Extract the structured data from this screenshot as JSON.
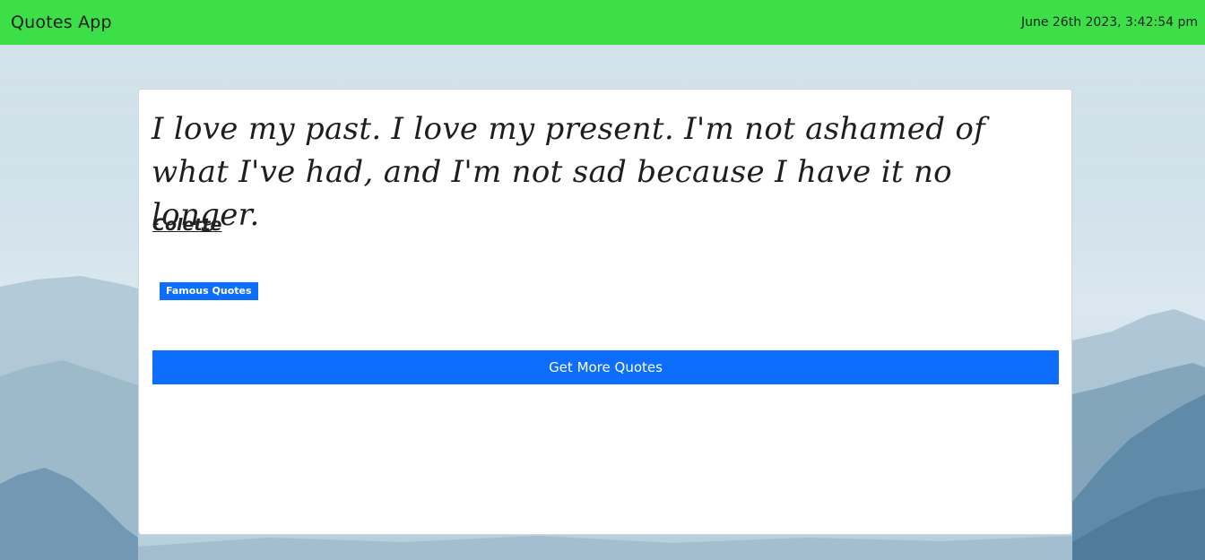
{
  "navbar": {
    "brand": "Quotes App",
    "datetime": "June 26th 2023, 3:42:54 pm",
    "background_color": "#3ddf48"
  },
  "quote": {
    "text": "I love my past. I love my present. I'm not ashamed of what I've had, and I'm not sad because I have it no longer.",
    "author": "Colette",
    "tags": [
      "Famous Quotes"
    ]
  },
  "actions": {
    "more_label": "Get More Quotes"
  },
  "colors": {
    "accent": "#0d6efd"
  }
}
